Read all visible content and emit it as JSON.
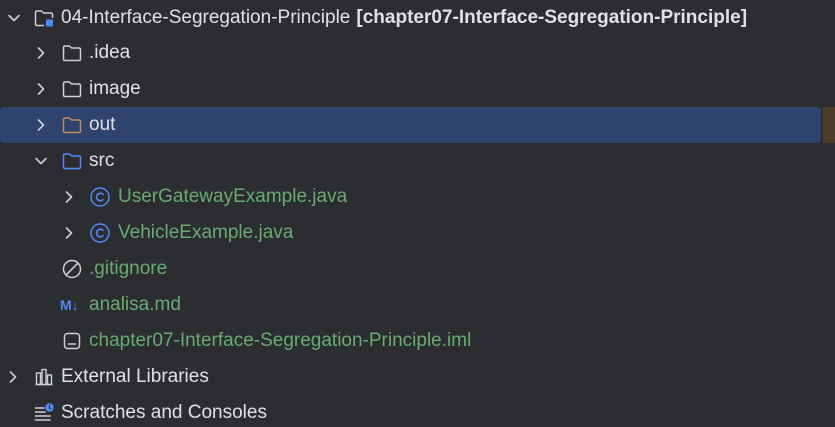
{
  "tree": {
    "root": {
      "name": "04-Interface-Segregation-Principle",
      "module": "[chapter07-Interface-Segregation-Principle]"
    },
    "items": [
      {
        "label": ".idea"
      },
      {
        "label": "image"
      },
      {
        "label": "out"
      },
      {
        "label": "src"
      },
      {
        "label": "UserGatewayExample.java"
      },
      {
        "label": "VehicleExample.java"
      },
      {
        "label": ".gitignore"
      },
      {
        "label": "analisa.md"
      },
      {
        "label": "chapter07-Interface-Segregation-Principle.iml"
      }
    ],
    "external_libraries": "External Libraries",
    "scratches": "Scratches and Consoles",
    "md_badge": "M↓"
  },
  "colors": {
    "background": "#2b2d30",
    "selection": "#2e436e",
    "text": "#dfe1e5",
    "vcs_added": "#6aab73",
    "excluded_folder": "#c98a5b",
    "source_folder": "#548af7",
    "class_icon": "#548af7"
  },
  "icons": {
    "expand": "chevron-right-icon",
    "collapse": "chevron-down-icon",
    "folder": "folder-icon",
    "module": "module-folder-icon",
    "class": "java-class-icon",
    "ignore": "ignore-file-icon",
    "markdown": "markdown-icon",
    "iml": "iml-file-icon",
    "libraries": "libraries-icon",
    "scratches": "scratches-icon"
  }
}
